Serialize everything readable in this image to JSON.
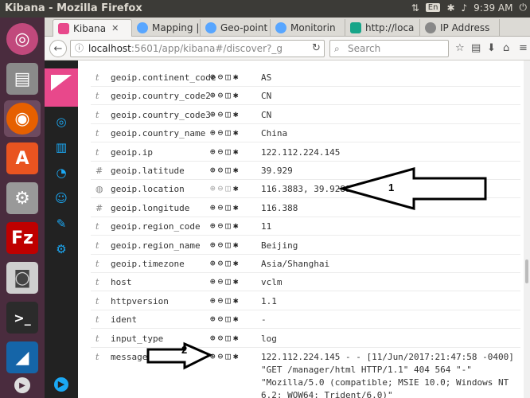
{
  "window": {
    "title": "Kibana - Mozilla Firefox",
    "lang": "En",
    "time": "9:39 AM"
  },
  "tabs": [
    {
      "label": "Kibana",
      "color": "#e8488b"
    },
    {
      "label": "Mapping |",
      "color": "#58a6ff"
    },
    {
      "label": "Geo-point",
      "color": "#58a6ff"
    },
    {
      "label": "Monitorin",
      "color": "#58a6ff"
    },
    {
      "label": "http://loca",
      "color": "#17a589"
    },
    {
      "label": "IP Address",
      "color": "#888888"
    }
  ],
  "navbar": {
    "url_host": "localhost",
    "url_rest": ":5601/app/kibana#/discover?_g",
    "search_placeholder": "Search"
  },
  "fields": [
    {
      "type": "t",
      "name": "geoip.continent_code",
      "value": "AS"
    },
    {
      "type": "t",
      "name": "geoip.country_code2",
      "value": "CN"
    },
    {
      "type": "t",
      "name": "geoip.country_code3",
      "value": "CN"
    },
    {
      "type": "t",
      "name": "geoip.country_name",
      "value": "China"
    },
    {
      "type": "t",
      "name": "geoip.ip",
      "value": "122.112.224.145"
    },
    {
      "type": "#",
      "name": "geoip.latitude",
      "value": "39.929"
    },
    {
      "type": "◍",
      "name": "geoip.location",
      "value": "116.3883, 39.9289"
    },
    {
      "type": "#",
      "name": "geoip.longitude",
      "value": "116.388"
    },
    {
      "type": "t",
      "name": "geoip.region_code",
      "value": "11"
    },
    {
      "type": "t",
      "name": "geoip.region_name",
      "value": "Beijing"
    },
    {
      "type": "t",
      "name": "geoip.timezone",
      "value": "Asia/Shanghai"
    },
    {
      "type": "t",
      "name": "host",
      "value": "vclm"
    },
    {
      "type": "t",
      "name": "httpversion",
      "value": "1.1"
    },
    {
      "type": "t",
      "name": "ident",
      "value": "-"
    },
    {
      "type": "t",
      "name": "input_type",
      "value": "log"
    },
    {
      "type": "t",
      "name": "message",
      "value": "122.112.224.145 - - [11/Jun/2017:21:47:58 -0400] \"GET /manager/html HTTP/1.1\" 404 564 \"-\" \"Mozilla/5.0 (compatible; MSIE 10.0; Windows NT 6.2; WOW64; Trident/6.0)\""
    }
  ],
  "annotations": {
    "arrow1": "1",
    "arrow2": "2"
  }
}
